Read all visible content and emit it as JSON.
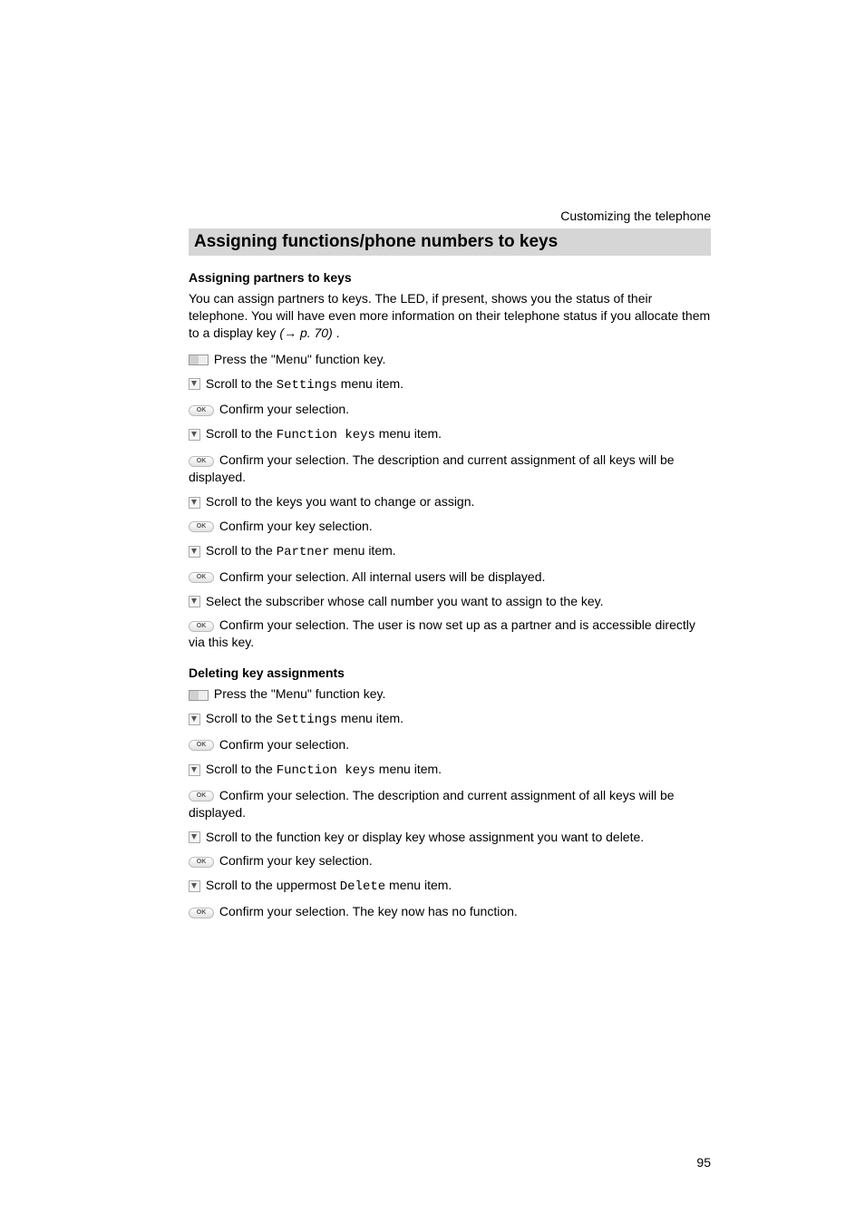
{
  "header": {
    "right": "Customizing the telephone"
  },
  "section_title": "Assigning functions/phone numbers to keys",
  "s1": {
    "heading": "Assigning partners to keys",
    "intro_a": "You can assign partners to keys. The LED, if present, shows you the status of their telephone. You will have even more information on their telephone status if you allocate them to a display key ",
    "intro_ref_open": "(",
    "intro_ref_arrow": "→",
    "intro_ref_page": " p. 70)",
    "intro_ref_close": " .",
    "step1": " Press the \"Menu\" function key.",
    "step2a": "  Scroll to the ",
    "step2m": "Settings",
    "step2b": " menu item.",
    "step3": "  Confirm your selection.",
    "step4a": "  Scroll to the ",
    "step4m": "Function keys",
    "step4b": " menu item.",
    "step5": "  Confirm your selection. The description and current assignment of all keys will be displayed.",
    "step6": " Scroll to the keys you want to change or assign.",
    "step7": " Confirm your key selection.",
    "step8a": " Scroll to the ",
    "step8m": "Partner",
    "step8b": " menu item.",
    "step9": "  Confirm your selection. All internal users will be displayed.",
    "step10": " Select the subscriber whose call number you want to assign to the key.",
    "step11": "  Confirm your selection. The user is now set up as a partner and is accessible directly via this key."
  },
  "s2": {
    "heading": "Deleting key assignments",
    "step1": "  Press the \"Menu\" function key.",
    "step2a": "  Scroll to the ",
    "step2m": "Settings",
    "step2b": " menu item.",
    "step3": "  Confirm your selection.",
    "step4a": "  Scroll to the ",
    "step4m": "Function keys",
    "step4b": " menu item.",
    "step5": "  Confirm your selection. The description and current assignment of all keys will be displayed.",
    "step6": " Scroll to the function key or display key whose assignment you want to delete.",
    "step7": " Confirm your key selection.",
    "step8a": " Scroll to the uppermost ",
    "step8m": "Delete",
    "step8b": " menu item.",
    "step9": "  Confirm your selection. The key now has no function."
  },
  "page_number": "95"
}
